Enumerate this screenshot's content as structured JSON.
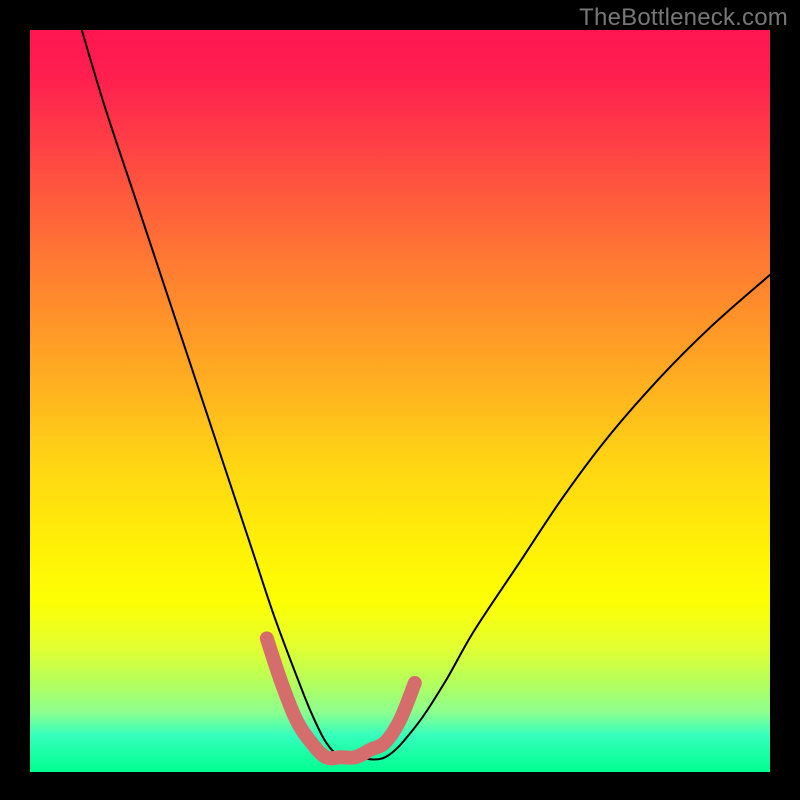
{
  "watermark": "TheBottleneck.com",
  "chart_data": {
    "type": "line",
    "title": "",
    "xlabel": "",
    "ylabel": "",
    "xlim": [
      0,
      100
    ],
    "ylim": [
      0,
      100
    ],
    "series": [
      {
        "name": "bottleneck-curve",
        "x": [
          7,
          10,
          14,
          18,
          22,
          26,
          30,
          33,
          36,
          38,
          40,
          42,
          44,
          48,
          52,
          56,
          60,
          66,
          72,
          78,
          85,
          92,
          100
        ],
        "values": [
          100,
          90,
          78,
          66,
          54,
          42,
          30,
          21,
          13,
          8,
          4,
          2,
          2,
          2,
          6,
          12,
          19,
          28,
          37,
          45,
          53,
          60,
          67
        ]
      },
      {
        "name": "optimal-zone-marker",
        "x": [
          32,
          34,
          36,
          38,
          40,
          42,
          44,
          46,
          48,
          50,
          52
        ],
        "values": [
          18,
          12,
          7,
          4,
          2,
          2,
          2,
          3,
          4,
          7,
          12
        ]
      }
    ]
  }
}
